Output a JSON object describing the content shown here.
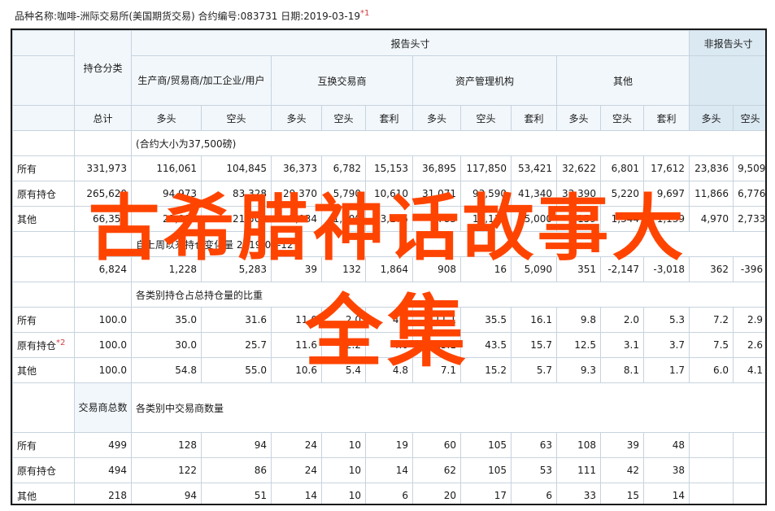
{
  "header": {
    "text": "品种名称:咖啡-洲际交易所(美国期货交易) 合约编号:083731 日期:2019-03-19",
    "note_mark": "*1"
  },
  "table": {
    "report_group": "报告头寸",
    "nonreport_group": "非报告头寸",
    "position_class": "持仓分类",
    "groups": [
      "生产商/贸易商/加工企业/用户",
      "互换交易商",
      "资产管理机构",
      "其他"
    ],
    "total_label": "总计",
    "subheaders": [
      "多头",
      "空头",
      "多头",
      "空头",
      "套利",
      "多头",
      "空头",
      "套利",
      "多头",
      "空头",
      "套利",
      "多头",
      "空头"
    ],
    "section1_note": "(合约大小为37,500磅)",
    "rows1": [
      {
        "label": "所有",
        "values": [
          "331,973",
          "116,061",
          "104,845",
          "36,373",
          "6,782",
          "15,153",
          "36,895",
          "117,850",
          "53,421",
          "32,622",
          "6,801",
          "17,612",
          "23,836",
          "9,509"
        ]
      },
      {
        "label": "原有持仓",
        "values": [
          "265,620",
          "94,973",
          "83,328",
          "29,370",
          "5,790",
          "10,610",
          "31,071",
          "93,590",
          "41,340",
          "33,390",
          "5,220",
          "9,697",
          "11,866",
          "6,776"
        ]
      },
      {
        "label": "其他",
        "values": [
          "66,353",
          "21,088",
          "21,509",
          "7,034",
          "1,000",
          "3,175",
          "4,783",
          "10,111",
          "5,000",
          "6,159",
          "1,344",
          "1,139",
          "4,970",
          "2,733"
        ]
      }
    ],
    "section2_note": "自上周以来持仓变化量 2019-03-12",
    "changes": [
      "6,824",
      "1,228",
      "5,283",
      "39",
      "132",
      "1,864",
      "908",
      "16",
      "5,090",
      "351",
      "-2,147",
      "-3,018",
      "362",
      "-396"
    ],
    "section3_note": "各类别持仓占总持仓量的比重",
    "rows3": [
      {
        "label": "所有",
        "values": [
          "100.0",
          "35.0",
          "31.6",
          "11.0",
          "2.0",
          "4.6",
          "11.1",
          "35.5",
          "16.1",
          "9.8",
          "2.0",
          "5.3",
          "7.2",
          "2.9"
        ]
      },
      {
        "label": "原有持仓",
        "label_mark": "*2",
        "values": [
          "100.0",
          "30.0",
          "25.7",
          "11.6",
          "2.2",
          "4.0",
          "15.1",
          "43.5",
          "15.7",
          "12.5",
          "3.1",
          "3.7",
          "7.5",
          "2.6"
        ]
      },
      {
        "label": "其他",
        "values": [
          "100.0",
          "54.8",
          "55.0",
          "10.6",
          "5.4",
          "4.8",
          "7.1",
          "15.2",
          "5.7",
          "9.3",
          "8.1",
          "1.7",
          "6.0",
          "4.1"
        ]
      }
    ],
    "trader_total_label": "交易商总数",
    "section4_note": "各类别中交易商数量",
    "rows4": [
      {
        "label": "所有",
        "values": [
          "499",
          "128",
          "94",
          "24",
          "10",
          "19",
          "60",
          "105",
          "63",
          "108",
          "39",
          "48",
          "",
          ""
        ]
      },
      {
        "label": "原有持仓",
        "values": [
          "494",
          "122",
          "86",
          "24",
          "10",
          "14",
          "62",
          "105",
          "53",
          "111",
          "42",
          "38",
          "",
          ""
        ]
      },
      {
        "label": "其他",
        "values": [
          "218",
          "94",
          "51",
          "14",
          "10",
          "6",
          "20",
          "17",
          "6",
          "33",
          "15",
          "14",
          "",
          ""
        ]
      }
    ]
  },
  "watermark": {
    "line1": "古希腊神话故事大",
    "line2": "全集"
  }
}
